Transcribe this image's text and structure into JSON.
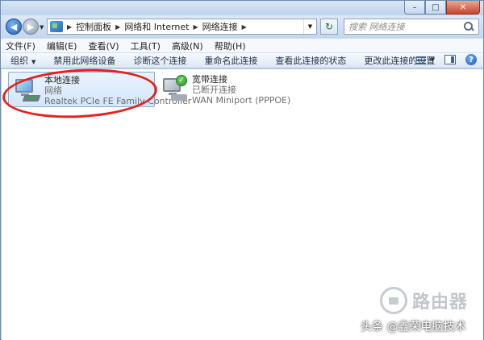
{
  "window": {
    "caption": {
      "minimize": "–",
      "maximize": "□",
      "close": "✕"
    }
  },
  "nav": {
    "back_glyph": "◀",
    "forward_glyph": "▶",
    "breadcrumb": [
      "控制面板",
      "网络和 Internet",
      "网络连接"
    ],
    "refresh_glyph": "↻",
    "search_placeholder": "搜索 网络连接"
  },
  "menu": {
    "items": [
      "文件(F)",
      "编辑(E)",
      "查看(V)",
      "工具(T)",
      "高级(N)",
      "帮助(H)"
    ]
  },
  "commands": {
    "organize": "组织",
    "disable_device": "禁用此网络设备",
    "diagnose": "诊断这个连接",
    "rename": "重命名此连接",
    "view_status": "查看此连接的状态",
    "change_settings": "更改此连接的设置",
    "help_glyph": "?"
  },
  "connections": [
    {
      "name": "本地连接",
      "status": "网络",
      "device": "Realtek PCIe FE Family Controller",
      "icon": "ethernet-adapter-icon",
      "selected": true
    },
    {
      "name": "宽带连接",
      "status": "已断开连接",
      "device": "WAN Miniport (PPPOE)",
      "icon": "broadband-modem-icon",
      "selected": false,
      "badge": "✓"
    }
  ],
  "watermark": {
    "logo_text": "路由器",
    "credit": "头条 @鑫荣电脑技术"
  },
  "colors": {
    "annotation": "#e8201b",
    "selection": "#d3e6fb",
    "status_ok": "#279a2e"
  }
}
